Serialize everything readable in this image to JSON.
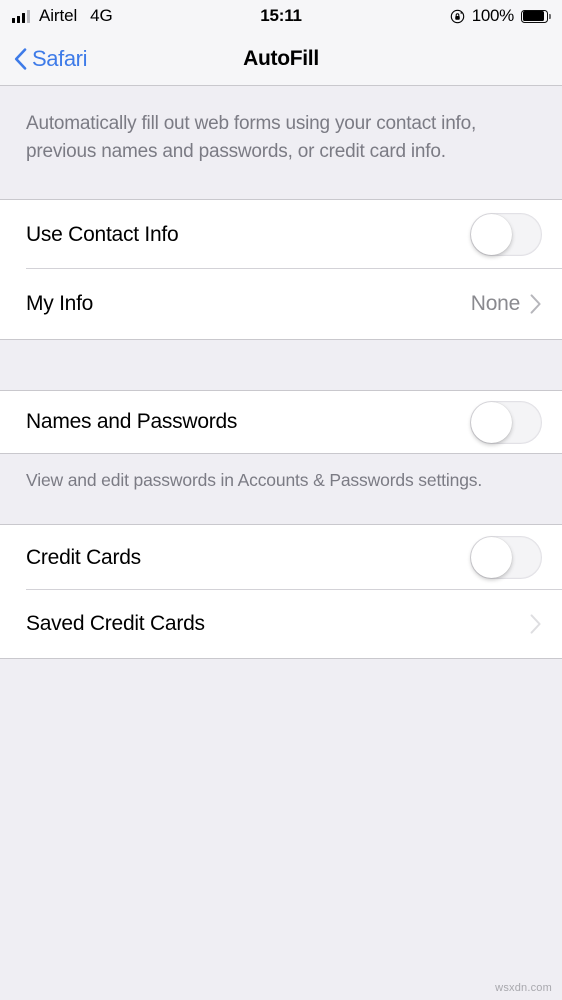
{
  "status_bar": {
    "carrier": "Airtel",
    "network": "4G",
    "time": "15:11",
    "battery_percent": "100%",
    "rotation_lock_icon": "rotation-lock-icon",
    "signal_icon": "signal-bars-icon",
    "battery_icon": "battery-full-icon"
  },
  "nav_bar": {
    "back_label": "Safari",
    "back_icon": "chevron-left-icon",
    "title": "AutoFill"
  },
  "header_description": "Automatically fill out web forms using your contact info, previous names and passwords, or credit card info.",
  "groups": [
    {
      "rows": [
        {
          "label": "Use Contact Info",
          "type": "toggle",
          "toggle_state": "off"
        },
        {
          "label": "My Info",
          "type": "disclosure",
          "value": "None",
          "chevron_icon": "chevron-right-icon"
        }
      ]
    },
    {
      "rows": [
        {
          "label": "Names and Passwords",
          "type": "toggle",
          "toggle_state": "off"
        }
      ],
      "footer": "View and edit passwords in Accounts & Passwords settings."
    },
    {
      "rows": [
        {
          "label": "Credit Cards",
          "type": "toggle",
          "toggle_state": "off"
        },
        {
          "label": "Saved Credit Cards",
          "type": "disclosure",
          "value": "",
          "chevron_icon": "chevron-right-icon"
        }
      ]
    }
  ],
  "watermark": "wsxdn.com",
  "colors": {
    "accent_blue": "#3E7BE8",
    "background": "#EFEEF3",
    "bar_background": "#F6F6F8",
    "row_background": "#FFFFFF",
    "secondary_text": "#8A8A8F",
    "description_text": "#7B7B84",
    "separator": "#D3D2D7"
  }
}
